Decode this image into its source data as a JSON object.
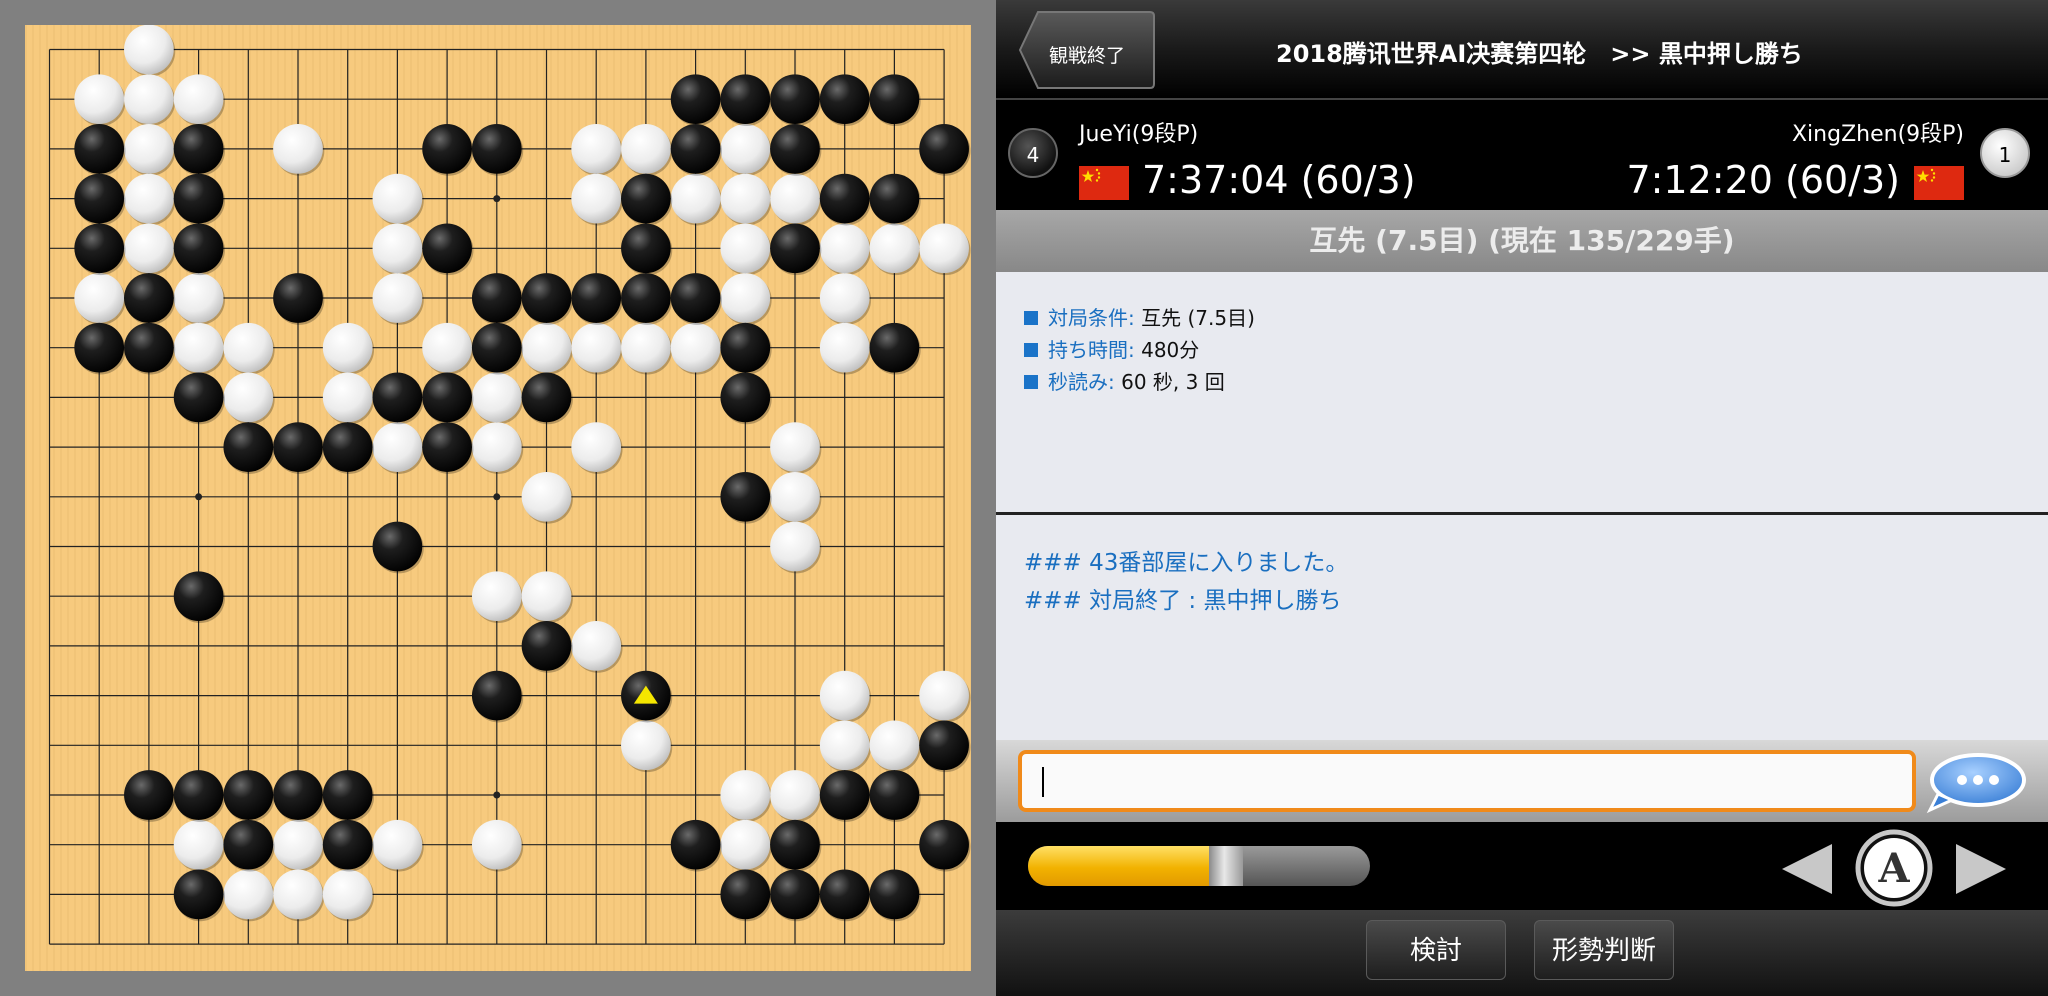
{
  "game": {
    "title": "2018腾讯世界AI决赛第四轮　>> 黒中押し勝ち",
    "back_label": "観戦終了",
    "black": {
      "name": "JueYi(9段P)",
      "rank_badge": "4",
      "time": "7:37:04 (60/3)",
      "flag": "china-flag"
    },
    "white": {
      "name": "XingZhen(9段P)",
      "rank_badge": "1",
      "time": "7:12:20 (60/3)",
      "flag": "china-flag"
    },
    "status": "互先 (7.5目) (現在 135/229手)"
  },
  "info": {
    "rules_label": "対局条件:",
    "rules_value": "互先 (7.5目)",
    "time_label": "持ち時間:",
    "time_value": "480分",
    "byoyomi_label": "秒読み:",
    "byoyomi_value": "60 秒, 3 回"
  },
  "chat": {
    "line1": "### 43番部屋に入りました。",
    "line2": "### 対局終了 : 黒中押し勝ち",
    "input_value": ""
  },
  "controls": {
    "progress": 0.589,
    "study_label": "検討",
    "judge_label": "形勢判断",
    "auto_label": "A"
  },
  "colors": {
    "board": "#f7c97b",
    "accent_orange": "#f08a1a",
    "info_blue": "#1a6fc0",
    "progress_yellow": "#f2b200",
    "last_move_marker": "#f5e600"
  },
  "board": {
    "size": 19,
    "last_move": [
      12,
      13
    ],
    "black_stones": [
      [
        13,
        1
      ],
      [
        14,
        1
      ],
      [
        15,
        1
      ],
      [
        16,
        1
      ],
      [
        17,
        1
      ],
      [
        1,
        2
      ],
      [
        3,
        2
      ],
      [
        8,
        2
      ],
      [
        9,
        2
      ],
      [
        13,
        2
      ],
      [
        15,
        2
      ],
      [
        18,
        2
      ],
      [
        1,
        3
      ],
      [
        3,
        3
      ],
      [
        12,
        3
      ],
      [
        16,
        3
      ],
      [
        17,
        3
      ],
      [
        1,
        4
      ],
      [
        3,
        4
      ],
      [
        8,
        4
      ],
      [
        12,
        4
      ],
      [
        15,
        4
      ],
      [
        2,
        5
      ],
      [
        5,
        5
      ],
      [
        9,
        5
      ],
      [
        10,
        5
      ],
      [
        11,
        5
      ],
      [
        12,
        5
      ],
      [
        13,
        5
      ],
      [
        1,
        6
      ],
      [
        2,
        6
      ],
      [
        9,
        6
      ],
      [
        14,
        6
      ],
      [
        17,
        6
      ],
      [
        3,
        7
      ],
      [
        7,
        7
      ],
      [
        8,
        7
      ],
      [
        10,
        7
      ],
      [
        14,
        7
      ],
      [
        4,
        8
      ],
      [
        5,
        8
      ],
      [
        6,
        8
      ],
      [
        8,
        8
      ],
      [
        14,
        9
      ],
      [
        7,
        10
      ],
      [
        3,
        11
      ],
      [
        10,
        12
      ],
      [
        9,
        13
      ],
      [
        12,
        13
      ],
      [
        18,
        14
      ],
      [
        2,
        15
      ],
      [
        3,
        15
      ],
      [
        4,
        15
      ],
      [
        5,
        15
      ],
      [
        6,
        15
      ],
      [
        16,
        15
      ],
      [
        17,
        15
      ],
      [
        4,
        16
      ],
      [
        6,
        16
      ],
      [
        13,
        16
      ],
      [
        15,
        16
      ],
      [
        18,
        16
      ],
      [
        3,
        17
      ],
      [
        14,
        17
      ],
      [
        15,
        17
      ],
      [
        16,
        17
      ],
      [
        17,
        17
      ]
    ],
    "white_stones": [
      [
        2,
        0
      ],
      [
        1,
        1
      ],
      [
        2,
        1
      ],
      [
        3,
        1
      ],
      [
        2,
        2
      ],
      [
        5,
        2
      ],
      [
        11,
        2
      ],
      [
        12,
        2
      ],
      [
        14,
        2
      ],
      [
        2,
        3
      ],
      [
        7,
        3
      ],
      [
        11,
        3
      ],
      [
        13,
        3
      ],
      [
        14,
        3
      ],
      [
        15,
        3
      ],
      [
        2,
        4
      ],
      [
        7,
        4
      ],
      [
        14,
        4
      ],
      [
        16,
        4
      ],
      [
        17,
        4
      ],
      [
        18,
        4
      ],
      [
        1,
        5
      ],
      [
        3,
        5
      ],
      [
        7,
        5
      ],
      [
        14,
        5
      ],
      [
        16,
        5
      ],
      [
        3,
        6
      ],
      [
        4,
        6
      ],
      [
        6,
        6
      ],
      [
        8,
        6
      ],
      [
        10,
        6
      ],
      [
        11,
        6
      ],
      [
        12,
        6
      ],
      [
        13,
        6
      ],
      [
        16,
        6
      ],
      [
        4,
        7
      ],
      [
        6,
        7
      ],
      [
        9,
        7
      ],
      [
        7,
        8
      ],
      [
        9,
        8
      ],
      [
        11,
        8
      ],
      [
        15,
        8
      ],
      [
        10,
        9
      ],
      [
        15,
        9
      ],
      [
        15,
        10
      ],
      [
        9,
        11
      ],
      [
        10,
        11
      ],
      [
        11,
        12
      ],
      [
        16,
        13
      ],
      [
        18,
        13
      ],
      [
        12,
        14
      ],
      [
        16,
        14
      ],
      [
        17,
        14
      ],
      [
        14,
        15
      ],
      [
        15,
        15
      ],
      [
        3,
        16
      ],
      [
        5,
        16
      ],
      [
        7,
        16
      ],
      [
        9,
        16
      ],
      [
        14,
        16
      ],
      [
        4,
        17
      ],
      [
        5,
        17
      ],
      [
        6,
        17
      ]
    ]
  }
}
